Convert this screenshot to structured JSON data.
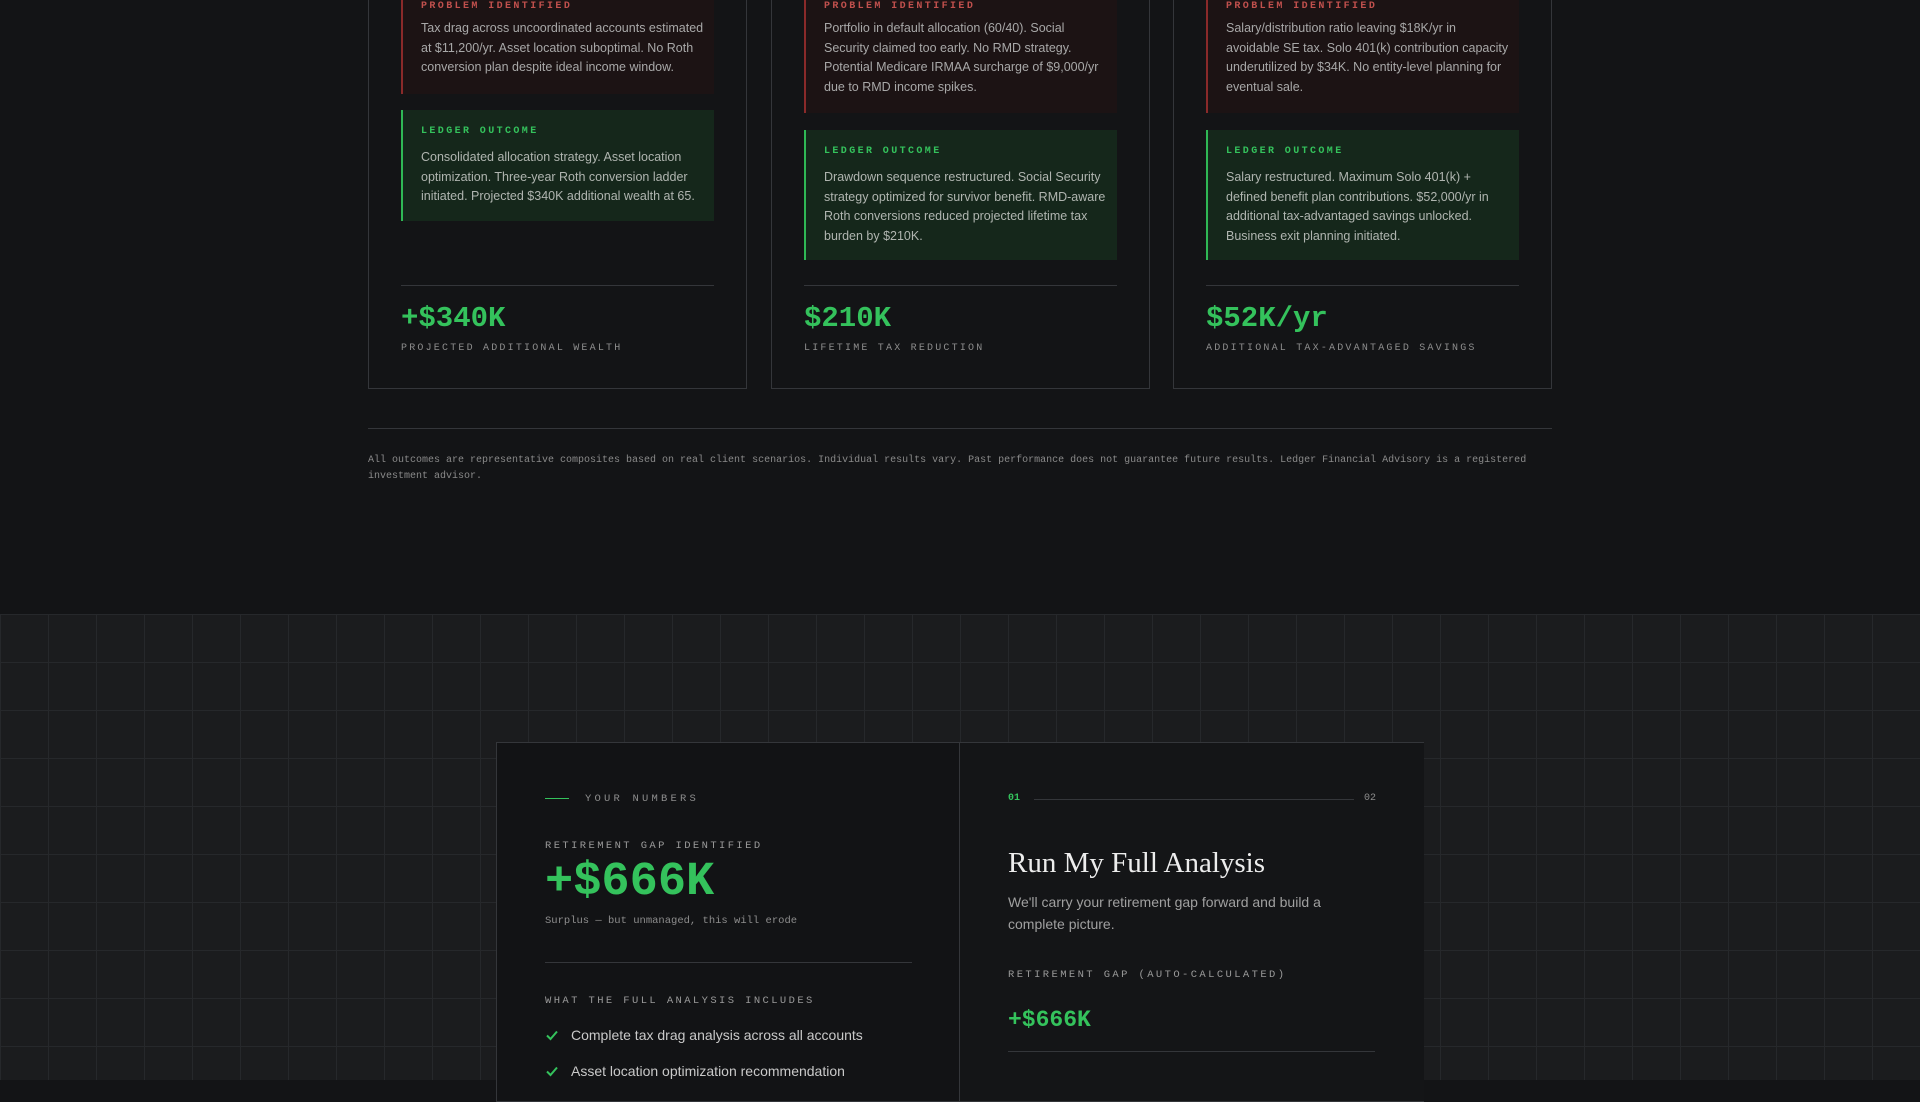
{
  "cases": [
    {
      "problem_label": "PROBLEM IDENTIFIED",
      "problem_text": "Tax drag across uncoordinated accounts estimated at $11,200/yr. Asset location suboptimal. No Roth conversion plan despite ideal income window.",
      "outcome_label": "LEDGER OUTCOME",
      "outcome_text": "Consolidated allocation strategy. Asset location optimization. Three-year Roth conversion ladder initiated. Projected $340K additional wealth at 65.",
      "metric_value": "+$340K",
      "metric_label": "PROJECTED ADDITIONAL WEALTH"
    },
    {
      "problem_label": "PROBLEM IDENTIFIED",
      "problem_text": "Portfolio in default allocation (60/40). Social Security claimed too early. No RMD strategy. Potential Medicare IRMAA surcharge of $9,000/yr due to RMD income spikes.",
      "outcome_label": "LEDGER OUTCOME",
      "outcome_text": "Drawdown sequence restructured. Social Security strategy optimized for survivor benefit. RMD-aware Roth conversions reduced projected lifetime tax burden by $210K.",
      "metric_value": "$210K",
      "metric_label": "LIFETIME TAX REDUCTION"
    },
    {
      "problem_label": "PROBLEM IDENTIFIED",
      "problem_text": "Salary/distribution ratio leaving $18K/yr in avoidable SE tax. Solo 401(k) contribution capacity underutilized by $34K. No entity-level planning for eventual sale.",
      "outcome_label": "LEDGER OUTCOME",
      "outcome_text": "Salary restructured. Maximum Solo 401(k) + defined benefit plan contributions. $52,000/yr in additional tax-advantaged savings unlocked. Business exit planning initiated.",
      "metric_value": "$52K/yr",
      "metric_label": "ADDITIONAL TAX-ADVANTAGED SAVINGS"
    }
  ],
  "disclaimer": "All outcomes are representative composites based on real client scenarios. Individual results vary. Past performance does not guarantee future results. Ledger Financial Advisory is a registered investment advisor.",
  "your_numbers": {
    "eyebrow": "YOUR NUMBERS",
    "gap_label": "RETIREMENT GAP IDENTIFIED",
    "gap_value": "+$666K",
    "gap_note": "Surplus — but unmanaged, this will erode",
    "includes_label": "WHAT THE FULL ANALYSIS INCLUDES",
    "includes": [
      "Complete tax drag analysis across all accounts",
      "Asset location optimization recommendation"
    ]
  },
  "analysis": {
    "step_current": "01",
    "step_total": "02",
    "title": "Run My Full Analysis",
    "description": "We'll carry your retirement gap forward and build a complete picture.",
    "auto_label": "RETIREMENT GAP (AUTO-CALCULATED)",
    "auto_value": "+$666K"
  },
  "colors": {
    "accent_green": "#34c25c",
    "problem_red": "#c0504d",
    "background": "#131416"
  },
  "icons": [
    "check-icon"
  ]
}
